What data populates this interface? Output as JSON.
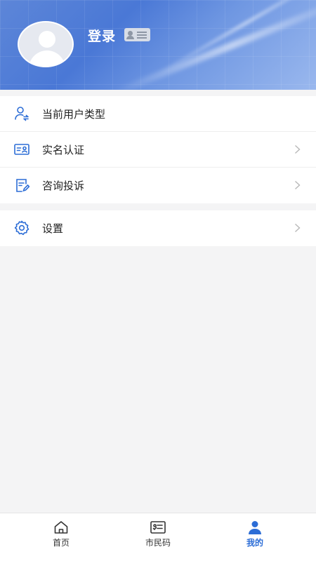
{
  "header": {
    "login_label": "登录"
  },
  "menu": {
    "group1": [
      {
        "label": "当前用户类型",
        "icon": "user-type-icon",
        "has_arrow": false
      },
      {
        "label": "实名认证",
        "icon": "id-card-icon",
        "has_arrow": true
      },
      {
        "label": "咨询投诉",
        "icon": "edit-doc-icon",
        "has_arrow": true
      }
    ],
    "group2": [
      {
        "label": "设置",
        "icon": "gear-icon",
        "has_arrow": true
      }
    ]
  },
  "tabbar": {
    "tabs": [
      {
        "label": "首页",
        "icon": "home-icon",
        "active": false
      },
      {
        "label": "市民码",
        "icon": "citizen-code-icon",
        "active": false
      },
      {
        "label": "我的",
        "icon": "profile-icon",
        "active": true
      }
    ]
  },
  "colors": {
    "accent": "#2c6dd6",
    "header": "#4a78d6",
    "background": "#f4f4f5"
  }
}
